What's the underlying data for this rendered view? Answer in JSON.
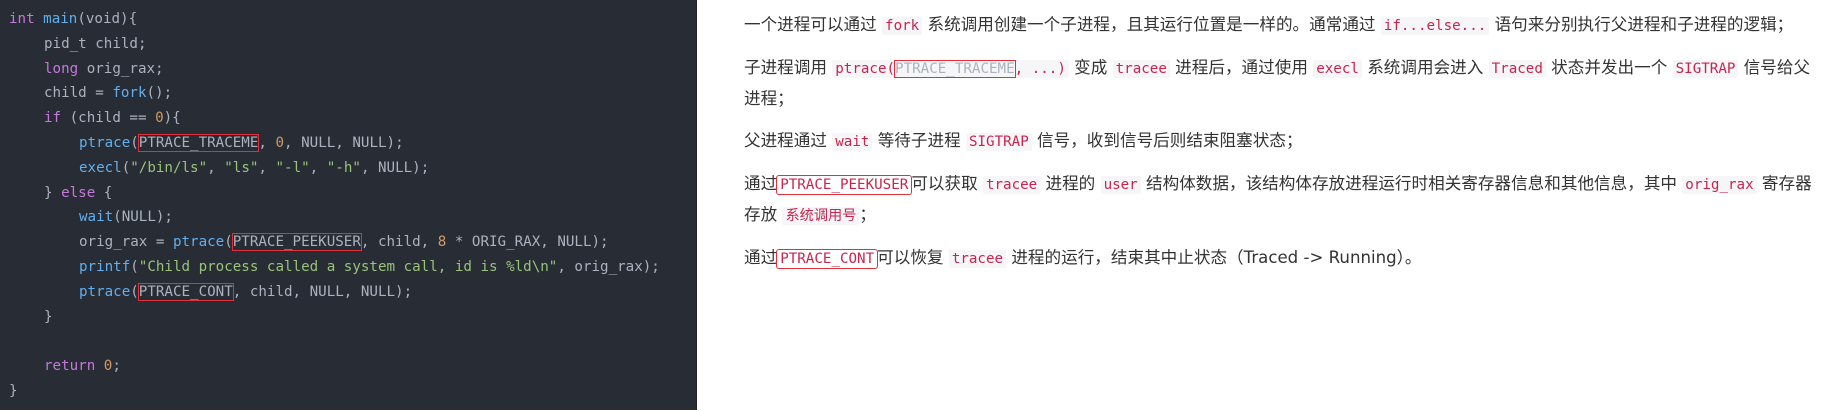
{
  "code": {
    "l1": {
      "kw": "int",
      "fn": "main",
      "rest": "(void){"
    },
    "l2": "pid_t child;",
    "l3": {
      "kw": "long",
      "rest": " orig_rax;"
    },
    "l4": {
      "pre": "child = ",
      "fn": "fork",
      "rest": "();"
    },
    "l5": {
      "kw": "if",
      "pre": " (child == ",
      "num": "0",
      "rest": "){"
    },
    "l6": {
      "fn": "ptrace",
      "open": "(",
      "boxed": "PTRACE_TRACEME",
      "mid": ", ",
      "num": "0",
      "rest": ", NULL, NULL);"
    },
    "l7": {
      "fn": "execl",
      "open": "(",
      "s1": "\"/bin/ls\"",
      "c1": ", ",
      "s2": "\"ls\"",
      "c2": ", ",
      "s3": "\"-l\"",
      "c3": ", ",
      "s4": "\"-h\"",
      "rest": ", NULL);"
    },
    "l8": {
      "pre": "} ",
      "kw": "else",
      "rest": " {"
    },
    "l9": {
      "fn": "wait",
      "rest": "(NULL);"
    },
    "l10": {
      "pre": "orig_rax = ",
      "fn": "ptrace",
      "open": "(",
      "boxed": "PTRACE_PEEKUSER",
      "mid": ", child, ",
      "num": "8",
      "rest": " * ORIG_RAX, NULL);"
    },
    "l11": {
      "fn": "printf",
      "open": "(",
      "str": "\"Child process called a system call, id is %ld\\n\"",
      "rest": ", orig_rax);"
    },
    "l12": {
      "fn": "ptrace",
      "open": "(",
      "boxed": "PTRACE_CONT",
      "rest": ", child, NULL, NULL);"
    },
    "l13": "}",
    "l15": {
      "kw": "return",
      "sp": " ",
      "num": "0",
      "rest": ";"
    },
    "l16": "}"
  },
  "text": {
    "p1": {
      "a": "一个进程可以通过 ",
      "c1": "fork",
      "b": " 系统调用创建一个子进程，且其运行位置是一样的。通常通过 ",
      "c2": "if...else...",
      "c": " 语句来分别执行父进程和子进程的逻辑；"
    },
    "p2": {
      "a": "子进程调用 ",
      "c1": "ptrace(",
      "c1box": "PTRACE_TRACEME",
      "c1end": ", ...)",
      "b": " 变成 ",
      "c2": "tracee",
      "c": " 进程后，通过使用 ",
      "c3": "execl",
      "d": " 系统调用会进入 ",
      "c4": "Traced",
      "e": " 状态并发出一个 ",
      "c5": "SIGTRAP",
      "f": " 信号给父进程；"
    },
    "p3": {
      "a": "父进程通过 ",
      "c1": "wait",
      "b": " 等待子进程 ",
      "c2": "SIGTRAP",
      "c": " 信号，收到信号后则结束阻塞状态；"
    },
    "p4": {
      "a": "通过",
      "c1": "PTRACE_PEEKUSER",
      "b": "可以获取 ",
      "c2": "tracee",
      "c": " 进程的 ",
      "c3": "user",
      "d": " 结构体数据，该结构体存放进程运行时相关寄存器信息和其他信息，其中 ",
      "c4": "orig_rax",
      "e": " 寄存器存放 ",
      "c5": "系统调用号",
      "f": "；"
    },
    "p5": {
      "a": "通过",
      "c1": "PTRACE_CONT",
      "b": "可以恢复 ",
      "c2": "tracee",
      "c": " 进程的运行，结束其中止状态（Traced -> Running）。"
    }
  }
}
